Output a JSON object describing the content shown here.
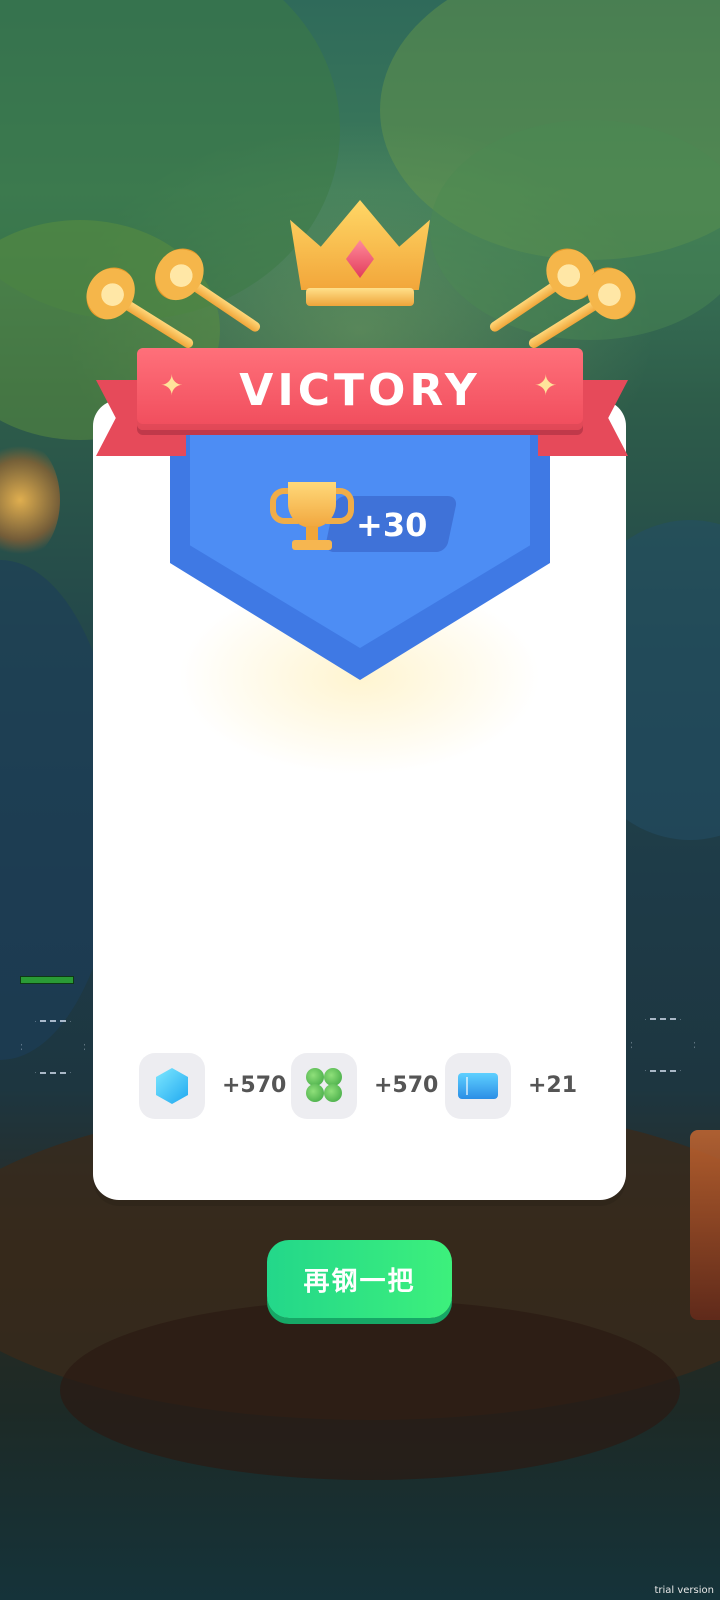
{
  "result": {
    "title": "VICTORY",
    "trophy_gain": "+30"
  },
  "rewards": [
    {
      "icon": "gem-icon",
      "value": "+570"
    },
    {
      "icon": "clover-icon",
      "value": "+570"
    },
    {
      "icon": "ticket-icon",
      "value": "+21"
    }
  ],
  "actions": {
    "play_again_label": "再钢一把"
  },
  "footer": {
    "watermark": "trial version"
  },
  "colors": {
    "ribbon": "#f04c5c",
    "shield": "#4d8df4",
    "button": "#2fe280",
    "card": "#ffffff"
  }
}
